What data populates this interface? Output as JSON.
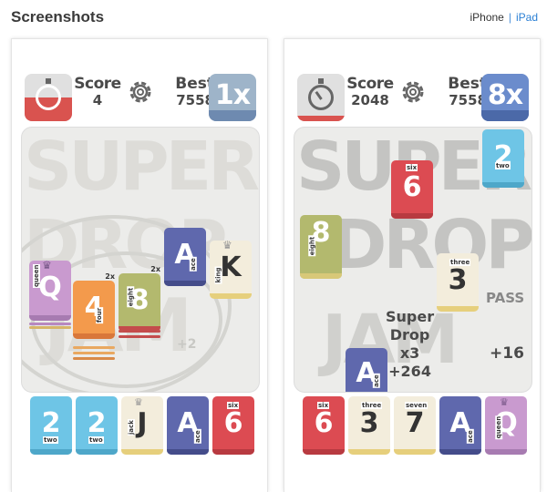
{
  "header": {
    "title": "Screenshots",
    "device_iphone": "iPhone",
    "separator": "|",
    "device_ipad": "iPad"
  },
  "shot1": {
    "score_label": "Score",
    "score_value": "4",
    "best_label": "Best",
    "best_value": "7558",
    "multiplier": "1x",
    "bg_words": [
      "SUPER",
      "DROP",
      "JAM"
    ],
    "board_tiles": [
      {
        "face": "Q",
        "word": "queen",
        "color": "purple"
      },
      {
        "face": "4",
        "word": "four",
        "color": "orange",
        "badge": "2x"
      },
      {
        "face": "8",
        "word": "eight",
        "color": "green",
        "badge": "2x"
      },
      {
        "face": "A",
        "word": "ace",
        "color": "navy"
      },
      {
        "face": "K",
        "word": "king",
        "color": "cream"
      }
    ],
    "float_bonus": "+2",
    "hand": [
      {
        "face": "2",
        "word": "two",
        "color": "blue"
      },
      {
        "face": "2",
        "word": "two",
        "color": "blue"
      },
      {
        "face": "J",
        "word": "jack",
        "color": "cream"
      },
      {
        "face": "A",
        "word": "ace",
        "color": "navy"
      },
      {
        "face": "6",
        "word": "six",
        "color": "red"
      }
    ]
  },
  "shot2": {
    "score_label": "Score",
    "score_value": "2048",
    "best_label": "Best",
    "best_value": "7558",
    "multiplier": "8x",
    "bg_words": [
      "SUPER",
      "DROP",
      "JAM"
    ],
    "board_tiles": [
      {
        "face": "2",
        "word": "two",
        "color": "blue"
      },
      {
        "face": "6",
        "word": "six",
        "color": "red"
      },
      {
        "face": "8",
        "word": "eight",
        "color": "green"
      },
      {
        "face": "3",
        "word": "three",
        "color": "cream"
      },
      {
        "face": "A",
        "word": "ace",
        "color": "navy"
      }
    ],
    "combo_line1": "Super",
    "combo_line2": "Drop",
    "combo_line3": "x3",
    "combo_line4": "+264",
    "pass_label": "PASS",
    "float_bonus": "+16",
    "hand": [
      {
        "face": "6",
        "word": "six",
        "color": "red"
      },
      {
        "face": "3",
        "word": "three",
        "color": "cream"
      },
      {
        "face": "7",
        "word": "seven",
        "color": "cream"
      },
      {
        "face": "A",
        "word": "ace",
        "color": "navy"
      },
      {
        "face": "Q",
        "word": "queen",
        "color": "purple"
      }
    ]
  },
  "colors": {
    "blue": "#6ec5e6",
    "green": "#b3b96e",
    "orange": "#f39a4c",
    "navy": "#5f68ad",
    "cream": "#f3eddc",
    "red": "#dc4b52",
    "purple": "#c99acf",
    "link": "#2a7fd4"
  },
  "icons": [
    "stopwatch-icon",
    "gear-icon",
    "crown-icon",
    "map-pin-icon"
  ]
}
